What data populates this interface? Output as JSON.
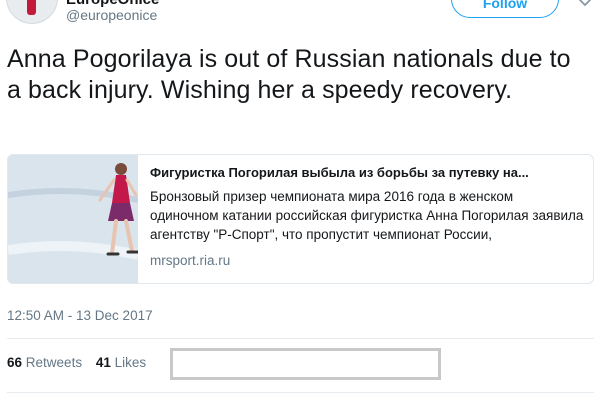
{
  "header": {
    "display_name": "EuropeOnIce",
    "handle": "@europeonice",
    "follow_label": "Follow",
    "caret_icon": "chevron-down-icon"
  },
  "tweet": {
    "text": "Anna Pogorilaya is out of Russian nationals due to a back injury. Wishing her a speedy recovery."
  },
  "card": {
    "image_icon": "figure-skater-photo",
    "title": "Фигуристка Погорилая выбыла из борьбы за путевку на...",
    "description": "Бронзовый призер чемпионата мира 2016 года в женском одиночном катании российская фигуристка Анна Погорилая заявила агентству \"Р-Спорт\", что пропустит чемпионат России,",
    "domain": "mrsport.ria.ru"
  },
  "meta": {
    "timestamp": "12:50 AM - 13 Dec 2017"
  },
  "stats": {
    "retweets_count": "66",
    "retweets_label": "Retweets",
    "likes_count": "41",
    "likes_label": "Likes"
  },
  "colors": {
    "accent": "#1da1f2",
    "secondary_text": "#657786",
    "divider": "#e6ecf0"
  }
}
